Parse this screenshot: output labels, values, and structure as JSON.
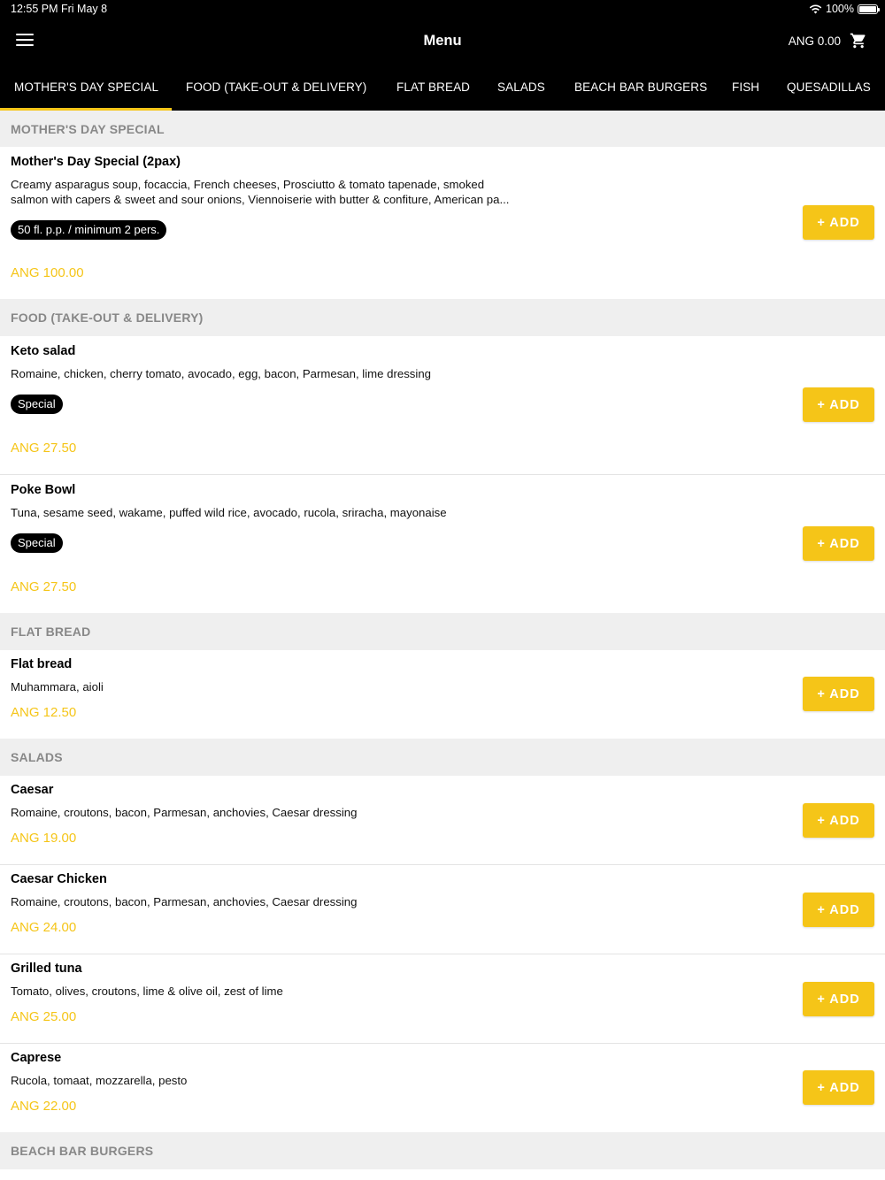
{
  "status": {
    "time": "12:55 PM",
    "date": "Fri May 8",
    "battery": "100%"
  },
  "header": {
    "title": "Menu",
    "cart_total": "ANG 0.00"
  },
  "tabs": [
    {
      "label": "MOTHER'S DAY SPECIAL",
      "active": true
    },
    {
      "label": "FOOD (TAKE-OUT & DELIVERY)"
    },
    {
      "label": "FLAT BREAD"
    },
    {
      "label": "SALADS"
    },
    {
      "label": "BEACH BAR BURGERS"
    },
    {
      "label": "FISH"
    },
    {
      "label": "QUESADILLAS"
    }
  ],
  "add_label": "+ ADD",
  "sections": [
    {
      "title": "MOTHER'S DAY SPECIAL",
      "items": [
        {
          "name": "Mother's Day Special (2pax)",
          "desc_line1": "Creamy asparagus soup, focaccia, French cheeses, Prosciutto & tomato tapenade, smoked",
          "desc_line2": "salmon with capers & sweet and sour onions, Viennoiserie with butter & confiture, American pa...",
          "badge": "50 fl. p.p. / minimum 2 pers.",
          "price": "ANG 100.00"
        }
      ]
    },
    {
      "title": "FOOD (TAKE-OUT & DELIVERY)",
      "items": [
        {
          "name": "Keto salad",
          "desc": "Romaine, chicken, cherry tomato, avocado, egg, bacon, Parmesan, lime dressing",
          "badge": "Special",
          "price": "ANG 27.50"
        },
        {
          "name": "Poke Bowl",
          "desc": "Tuna, sesame seed, wakame, puffed wild rice, avocado, rucola, sriracha, mayonaise",
          "badge": "Special",
          "price": "ANG 27.50"
        }
      ]
    },
    {
      "title": "FLAT BREAD",
      "items": [
        {
          "name": "Flat bread",
          "desc": "Muhammara, aioli",
          "price": "ANG 12.50"
        }
      ]
    },
    {
      "title": "SALADS",
      "items": [
        {
          "name": "Caesar",
          "desc": "Romaine, croutons, bacon, Parmesan, anchovies, Caesar dressing",
          "price": "ANG 19.00"
        },
        {
          "name": "Caesar Chicken",
          "desc": "Romaine, croutons, bacon, Parmesan, anchovies, Caesar dressing",
          "price": "ANG 24.00"
        },
        {
          "name": "Grilled tuna",
          "desc": "Tomato, olives, croutons, lime & olive oil, zest of lime",
          "price": "ANG 25.00"
        },
        {
          "name": "Caprese",
          "desc": "Rucola, tomaat, mozzarella, pesto",
          "price": "ANG 22.00"
        }
      ]
    },
    {
      "title": "BEACH BAR BURGERS",
      "items": []
    }
  ],
  "colors": {
    "accent": "#f5c518",
    "bar": "#000000",
    "section_bg": "#efefef",
    "section_text": "#888888"
  }
}
